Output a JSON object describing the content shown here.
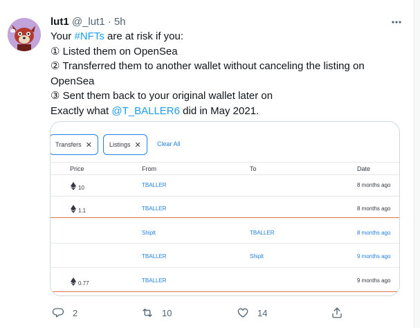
{
  "tweet": {
    "author_name": "lut1",
    "author_handle": "@_lut1",
    "separator": "·",
    "time": "5h",
    "lines": {
      "l1_pre": "Your ",
      "l1_link": "#NFTs",
      "l1_post": " are at risk if you:",
      "l2": "① Listed them on OpenSea",
      "l3": "② Transferred them to another wallet without canceling the listing on",
      "l4": "OpenSea",
      "l5": "③ Sent them back to your original wallet later on",
      "l6_pre": "Exactly what ",
      "l6_link": "@T_BALLER6",
      "l6_post": " did in May 2021."
    }
  },
  "embed": {
    "chips": [
      {
        "label": "Transfers",
        "close": "✕"
      },
      {
        "label": "Listings",
        "close": "✕"
      }
    ],
    "clear_all": "Clear All",
    "columns": {
      "price": "Price",
      "from": "From",
      "to": "To",
      "date": "Date"
    },
    "rows": [
      {
        "price": "10",
        "from": "TBALLER",
        "to": "",
        "date": "8 months ago",
        "date_link": false
      },
      {
        "price": "1.1",
        "from": "TBALLER",
        "to": "",
        "date": "8 months ago",
        "date_link": false
      },
      {
        "price": "",
        "from": "Shiplt",
        "to": "TBALLER",
        "date": "8 months ago",
        "date_link": true
      },
      {
        "price": "",
        "from": "TBALLER",
        "to": "Shiplt",
        "date": "9 months ago",
        "date_link": true
      },
      {
        "price": "0.77",
        "from": "TBALLER",
        "to": "",
        "date": "9 months ago",
        "date_link": false
      }
    ]
  },
  "actions": {
    "replies": "2",
    "retweets": "10",
    "likes": "14"
  },
  "colors": {
    "link": "#1d9bf0",
    "opensea_blue": "#2081e2",
    "highlight_line": "#e0734e",
    "avatar_bg": "#c1a4da"
  }
}
